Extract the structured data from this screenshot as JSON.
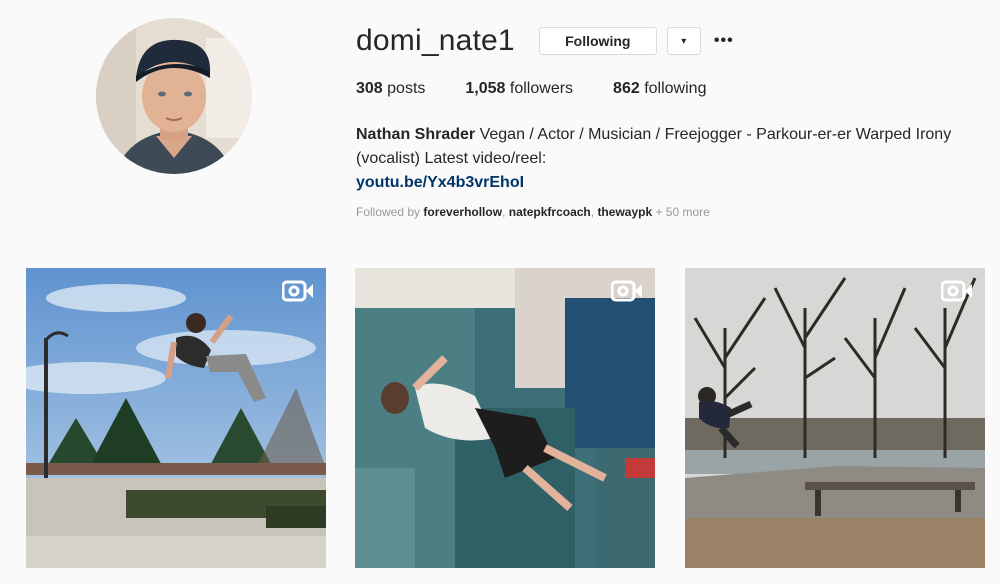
{
  "profile": {
    "username": "domi_nate1",
    "following_button": "Following",
    "dropdown_glyph": "▾",
    "more_glyph": "•••",
    "avatar_icon": "profile-avatar"
  },
  "stats": {
    "posts_count": "308",
    "posts_label": "posts",
    "followers_count": "1,058",
    "followers_label": "followers",
    "following_count": "862",
    "following_label": "following"
  },
  "bio": {
    "full_name": "Nathan Shrader",
    "text": " Vegan / Actor / Musician / Freejogger - Parkour-er-er Warped Irony (vocalist) Latest video/reel:",
    "link": "youtu.be/Yx4b3vrEhoI"
  },
  "followed_by": {
    "prefix": "Followed by ",
    "users": [
      "foreverhollow",
      "natepkfrcoach",
      "thewaypk"
    ],
    "sep1": ", ",
    "sep2": ", ",
    "more": " + 50 more"
  },
  "posts": [
    {
      "type": "video",
      "icon": "video-camera-icon"
    },
    {
      "type": "video",
      "icon": "video-camera-icon"
    },
    {
      "type": "video",
      "icon": "video-camera-icon"
    }
  ],
  "colors": {
    "background": "#fafafa",
    "text": "#262626",
    "link": "#003569",
    "muted": "#999999",
    "border": "#dbdbdb"
  }
}
